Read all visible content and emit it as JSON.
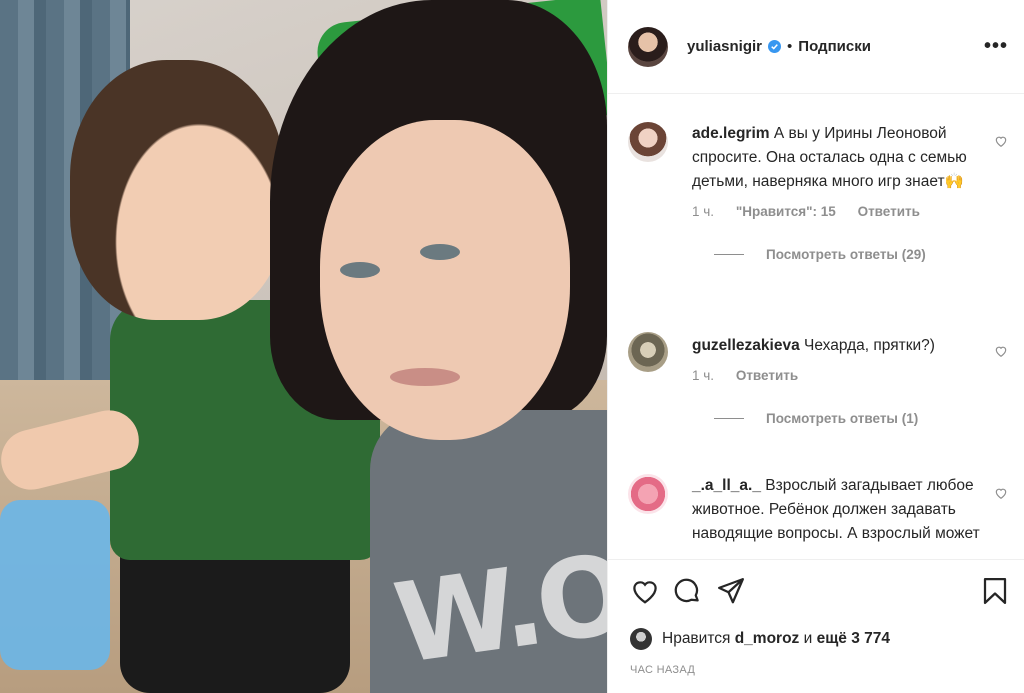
{
  "post": {
    "owner": "yuliasnigir",
    "follow_label": "Подписки",
    "dot": "•",
    "more_label": "•••"
  },
  "comments": [
    {
      "user": "ade.legrim",
      "text": "А вы у Ирины Леоновой спросите. Она осталась одна с семью детьми, наверняка много игр знает🙌",
      "time": "1 ч.",
      "likes": "\"Нравится\": 15",
      "reply_label": "Ответить",
      "view_replies": "Посмотреть ответы (29)"
    },
    {
      "user": "guzellezakieva",
      "text": "Чехарда, прятки?)",
      "time": "1 ч.",
      "reply_label": "Ответить",
      "view_replies": "Посмотреть ответы (1)"
    },
    {
      "user": "_.a_ll_a._",
      "text": "Взрослый загадывает любое животное. Ребёнок должен задавать наводящие вопросы. А взрослый может"
    }
  ],
  "likes": {
    "prefix": "Нравится",
    "user": "d_moroz",
    "conj": "и",
    "more": "ещё 3 774"
  },
  "timestamp": "ЧАС НАЗАД",
  "photo": {
    "shirt_print": "W.O"
  },
  "colors": {
    "verified": "#3897f0",
    "muted": "#8e8e8e",
    "text": "#262626"
  }
}
